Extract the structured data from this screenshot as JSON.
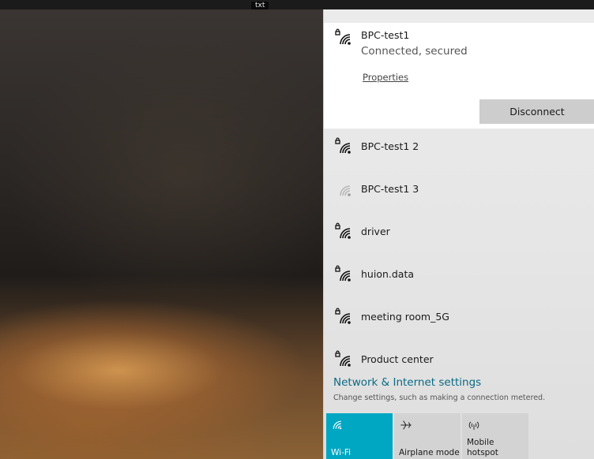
{
  "desktop": {
    "label": "txt"
  },
  "wifi_flyout": {
    "connected_network": {
      "name": "BPC-test1",
      "status": "Connected, secured",
      "properties_label": "Properties",
      "disconnect_label": "Disconnect",
      "icon": "wifi-secured-icon"
    },
    "networks": [
      {
        "name": "BPC-test1 2",
        "icon": "wifi-secured-icon",
        "secured": true
      },
      {
        "name": "BPC-test1 3",
        "icon": "wifi-weak-icon",
        "secured": false
      },
      {
        "name": "driver",
        "icon": "wifi-secured-icon",
        "secured": true
      },
      {
        "name": "huion.data",
        "icon": "wifi-secured-icon",
        "secured": true
      },
      {
        "name": "meeting room_5G",
        "icon": "wifi-secured-icon",
        "secured": true
      },
      {
        "name": "Product center",
        "icon": "wifi-secured-icon",
        "secured": true
      }
    ],
    "settings": {
      "title": "Network & Internet settings",
      "subtitle": "Change settings, such as making a connection metered."
    },
    "quick_actions": [
      {
        "label": "Wi-Fi",
        "icon": "wifi-icon",
        "active": true
      },
      {
        "label": "Airplane mode",
        "icon": "airplane-icon",
        "active": false
      },
      {
        "label": "Mobile hotspot",
        "label_line1": "Mobile",
        "label_line2": "hotspot",
        "icon": "hotspot-icon",
        "active": false
      }
    ],
    "colors": {
      "accent": "#00a7c2",
      "link": "#0a6a84",
      "connected_bg": "#ffffff",
      "button_bg": "#cdcdcd",
      "tile_bg": "#d3d3d3"
    }
  }
}
